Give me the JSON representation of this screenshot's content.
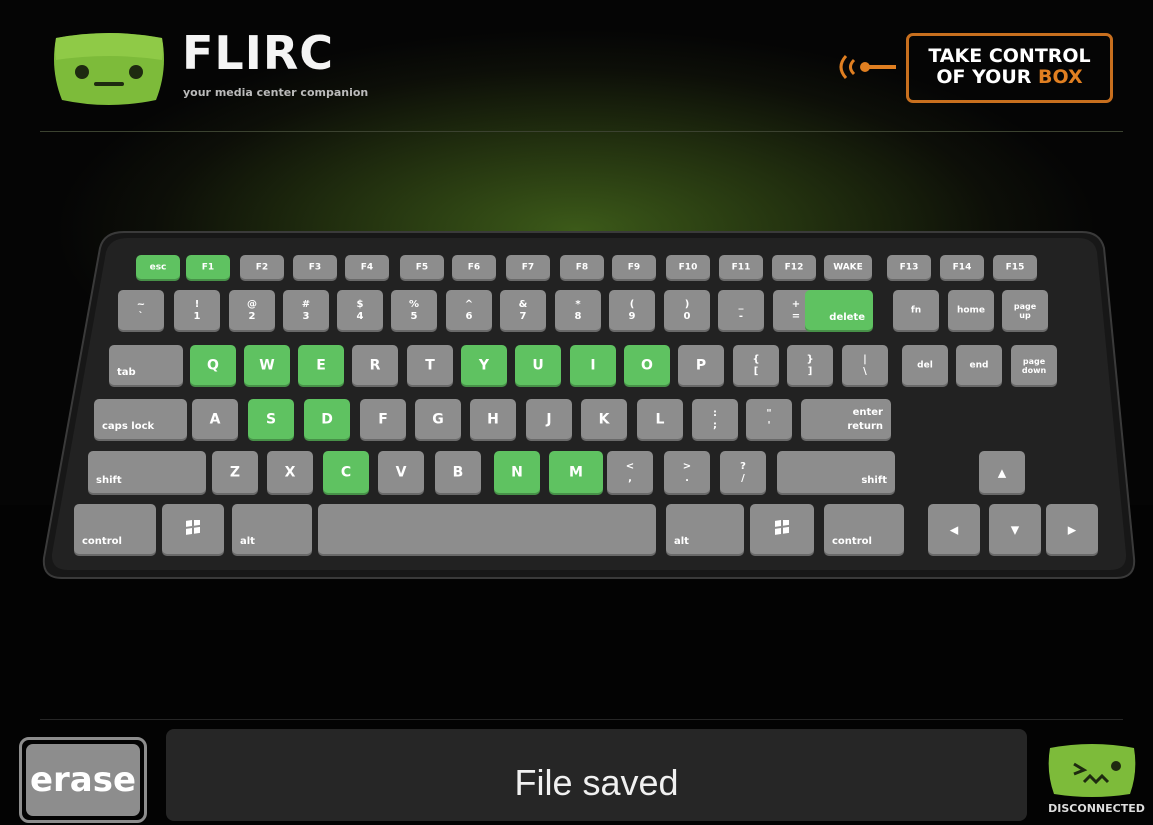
{
  "app": {
    "name": "FLIRC",
    "tagline": "your media center companion",
    "promo_line1": "TAKE CONTROL",
    "promo_line2_prefix": "OF YOUR",
    "promo_line2_highlight": "BOX"
  },
  "icons": {
    "logo": "flirc-monster-face-icon",
    "signal": "ir-signal-icon",
    "connection": "sad-monster-disconnected-icon",
    "windows": "windows-logo-icon"
  },
  "colors": {
    "accent_green": "#5fc261",
    "accent_orange": "#e07f21",
    "key_gray": "#8d8d8d",
    "panel_bg": "#262626"
  },
  "keyboard": {
    "row1": [
      {
        "label": "esc",
        "on": true
      },
      {
        "label": "F1",
        "on": true
      },
      {
        "label": "F2",
        "on": false
      },
      {
        "label": "F3",
        "on": false
      },
      {
        "label": "F4",
        "on": false
      },
      {
        "label": "F5",
        "on": false
      },
      {
        "label": "F6",
        "on": false
      },
      {
        "label": "F7",
        "on": false
      },
      {
        "label": "F8",
        "on": false
      },
      {
        "label": "F9",
        "on": false
      },
      {
        "label": "F10",
        "on": false
      },
      {
        "label": "F11",
        "on": false
      },
      {
        "label": "F12",
        "on": false
      },
      {
        "label": "WAKE",
        "on": false
      },
      {
        "label": "F13",
        "on": false
      },
      {
        "label": "F14",
        "on": false
      },
      {
        "label": "F15",
        "on": false
      }
    ],
    "row2": [
      {
        "top": "~",
        "bottom": "`",
        "on": false
      },
      {
        "top": "!",
        "bottom": "1",
        "on": false
      },
      {
        "top": "@",
        "bottom": "2",
        "on": false
      },
      {
        "top": "#",
        "bottom": "3",
        "on": false
      },
      {
        "top": "$",
        "bottom": "4",
        "on": false
      },
      {
        "top": "%",
        "bottom": "5",
        "on": false
      },
      {
        "top": "^",
        "bottom": "6",
        "on": false
      },
      {
        "top": "&",
        "bottom": "7",
        "on": false
      },
      {
        "top": "*",
        "bottom": "8",
        "on": false
      },
      {
        "top": "(",
        "bottom": "9",
        "on": false
      },
      {
        "top": ")",
        "bottom": "0",
        "on": false
      },
      {
        "top": "_",
        "bottom": "-",
        "on": false
      },
      {
        "top": "+",
        "bottom": "=",
        "on": false
      },
      {
        "label": "delete",
        "on": true
      },
      {
        "label": "fn",
        "on": false
      },
      {
        "label": "home",
        "on": false
      },
      {
        "top": "page",
        "bottom": "up",
        "on": false
      }
    ],
    "row3": [
      {
        "label": "tab",
        "on": false
      },
      {
        "label": "Q",
        "on": true
      },
      {
        "label": "W",
        "on": true
      },
      {
        "label": "E",
        "on": true
      },
      {
        "label": "R",
        "on": false
      },
      {
        "label": "T",
        "on": false
      },
      {
        "label": "Y",
        "on": true
      },
      {
        "label": "U",
        "on": true
      },
      {
        "label": "I",
        "on": true
      },
      {
        "label": "O",
        "on": true
      },
      {
        "label": "P",
        "on": false
      },
      {
        "top": "{",
        "bottom": "[",
        "on": false
      },
      {
        "top": "}",
        "bottom": "]",
        "on": false
      },
      {
        "top": "|",
        "bottom": "\\",
        "on": false
      },
      {
        "label": "del",
        "on": false
      },
      {
        "label": "end",
        "on": false
      },
      {
        "top": "page",
        "bottom": "down",
        "on": false
      }
    ],
    "row4": [
      {
        "label": "caps lock",
        "on": false
      },
      {
        "label": "A",
        "on": false
      },
      {
        "label": "S",
        "on": true
      },
      {
        "label": "D",
        "on": true
      },
      {
        "label": "F",
        "on": false
      },
      {
        "label": "G",
        "on": false
      },
      {
        "label": "H",
        "on": false
      },
      {
        "label": "J",
        "on": false
      },
      {
        "label": "K",
        "on": false
      },
      {
        "label": "L",
        "on": false
      },
      {
        "top": ":",
        "bottom": ";",
        "on": false
      },
      {
        "top": "\"",
        "bottom": "'",
        "on": false
      },
      {
        "top": "enter",
        "bottom": "return",
        "on": false
      }
    ],
    "row5": [
      {
        "label": "shift",
        "on": false
      },
      {
        "label": "Z",
        "on": false
      },
      {
        "label": "X",
        "on": false
      },
      {
        "label": "C",
        "on": true
      },
      {
        "label": "V",
        "on": false
      },
      {
        "label": "B",
        "on": false
      },
      {
        "label": "N",
        "on": true
      },
      {
        "label": "M",
        "on": true
      },
      {
        "top": "<",
        "bottom": ",",
        "on": false
      },
      {
        "top": ">",
        "bottom": ".",
        "on": false
      },
      {
        "top": "?",
        "bottom": "/",
        "on": false
      },
      {
        "label": "shift",
        "on": false
      },
      {
        "label": "▲",
        "on": false
      }
    ],
    "row6": [
      {
        "label": "control",
        "on": false
      },
      {
        "label": "",
        "on": false,
        "icon": "windows-logo-icon"
      },
      {
        "label": "alt",
        "on": false
      },
      {
        "label": "",
        "on": false
      },
      {
        "label": "alt",
        "on": false
      },
      {
        "label": "",
        "on": false,
        "icon": "windows-logo-icon"
      },
      {
        "label": "control",
        "on": false
      },
      {
        "label": "◀",
        "on": false
      },
      {
        "label": "▼",
        "on": false
      },
      {
        "label": "▶",
        "on": false
      }
    ]
  },
  "footer": {
    "erase_label": "erase",
    "status_message": "File saved",
    "connection_status": "DISCONNECTED"
  }
}
